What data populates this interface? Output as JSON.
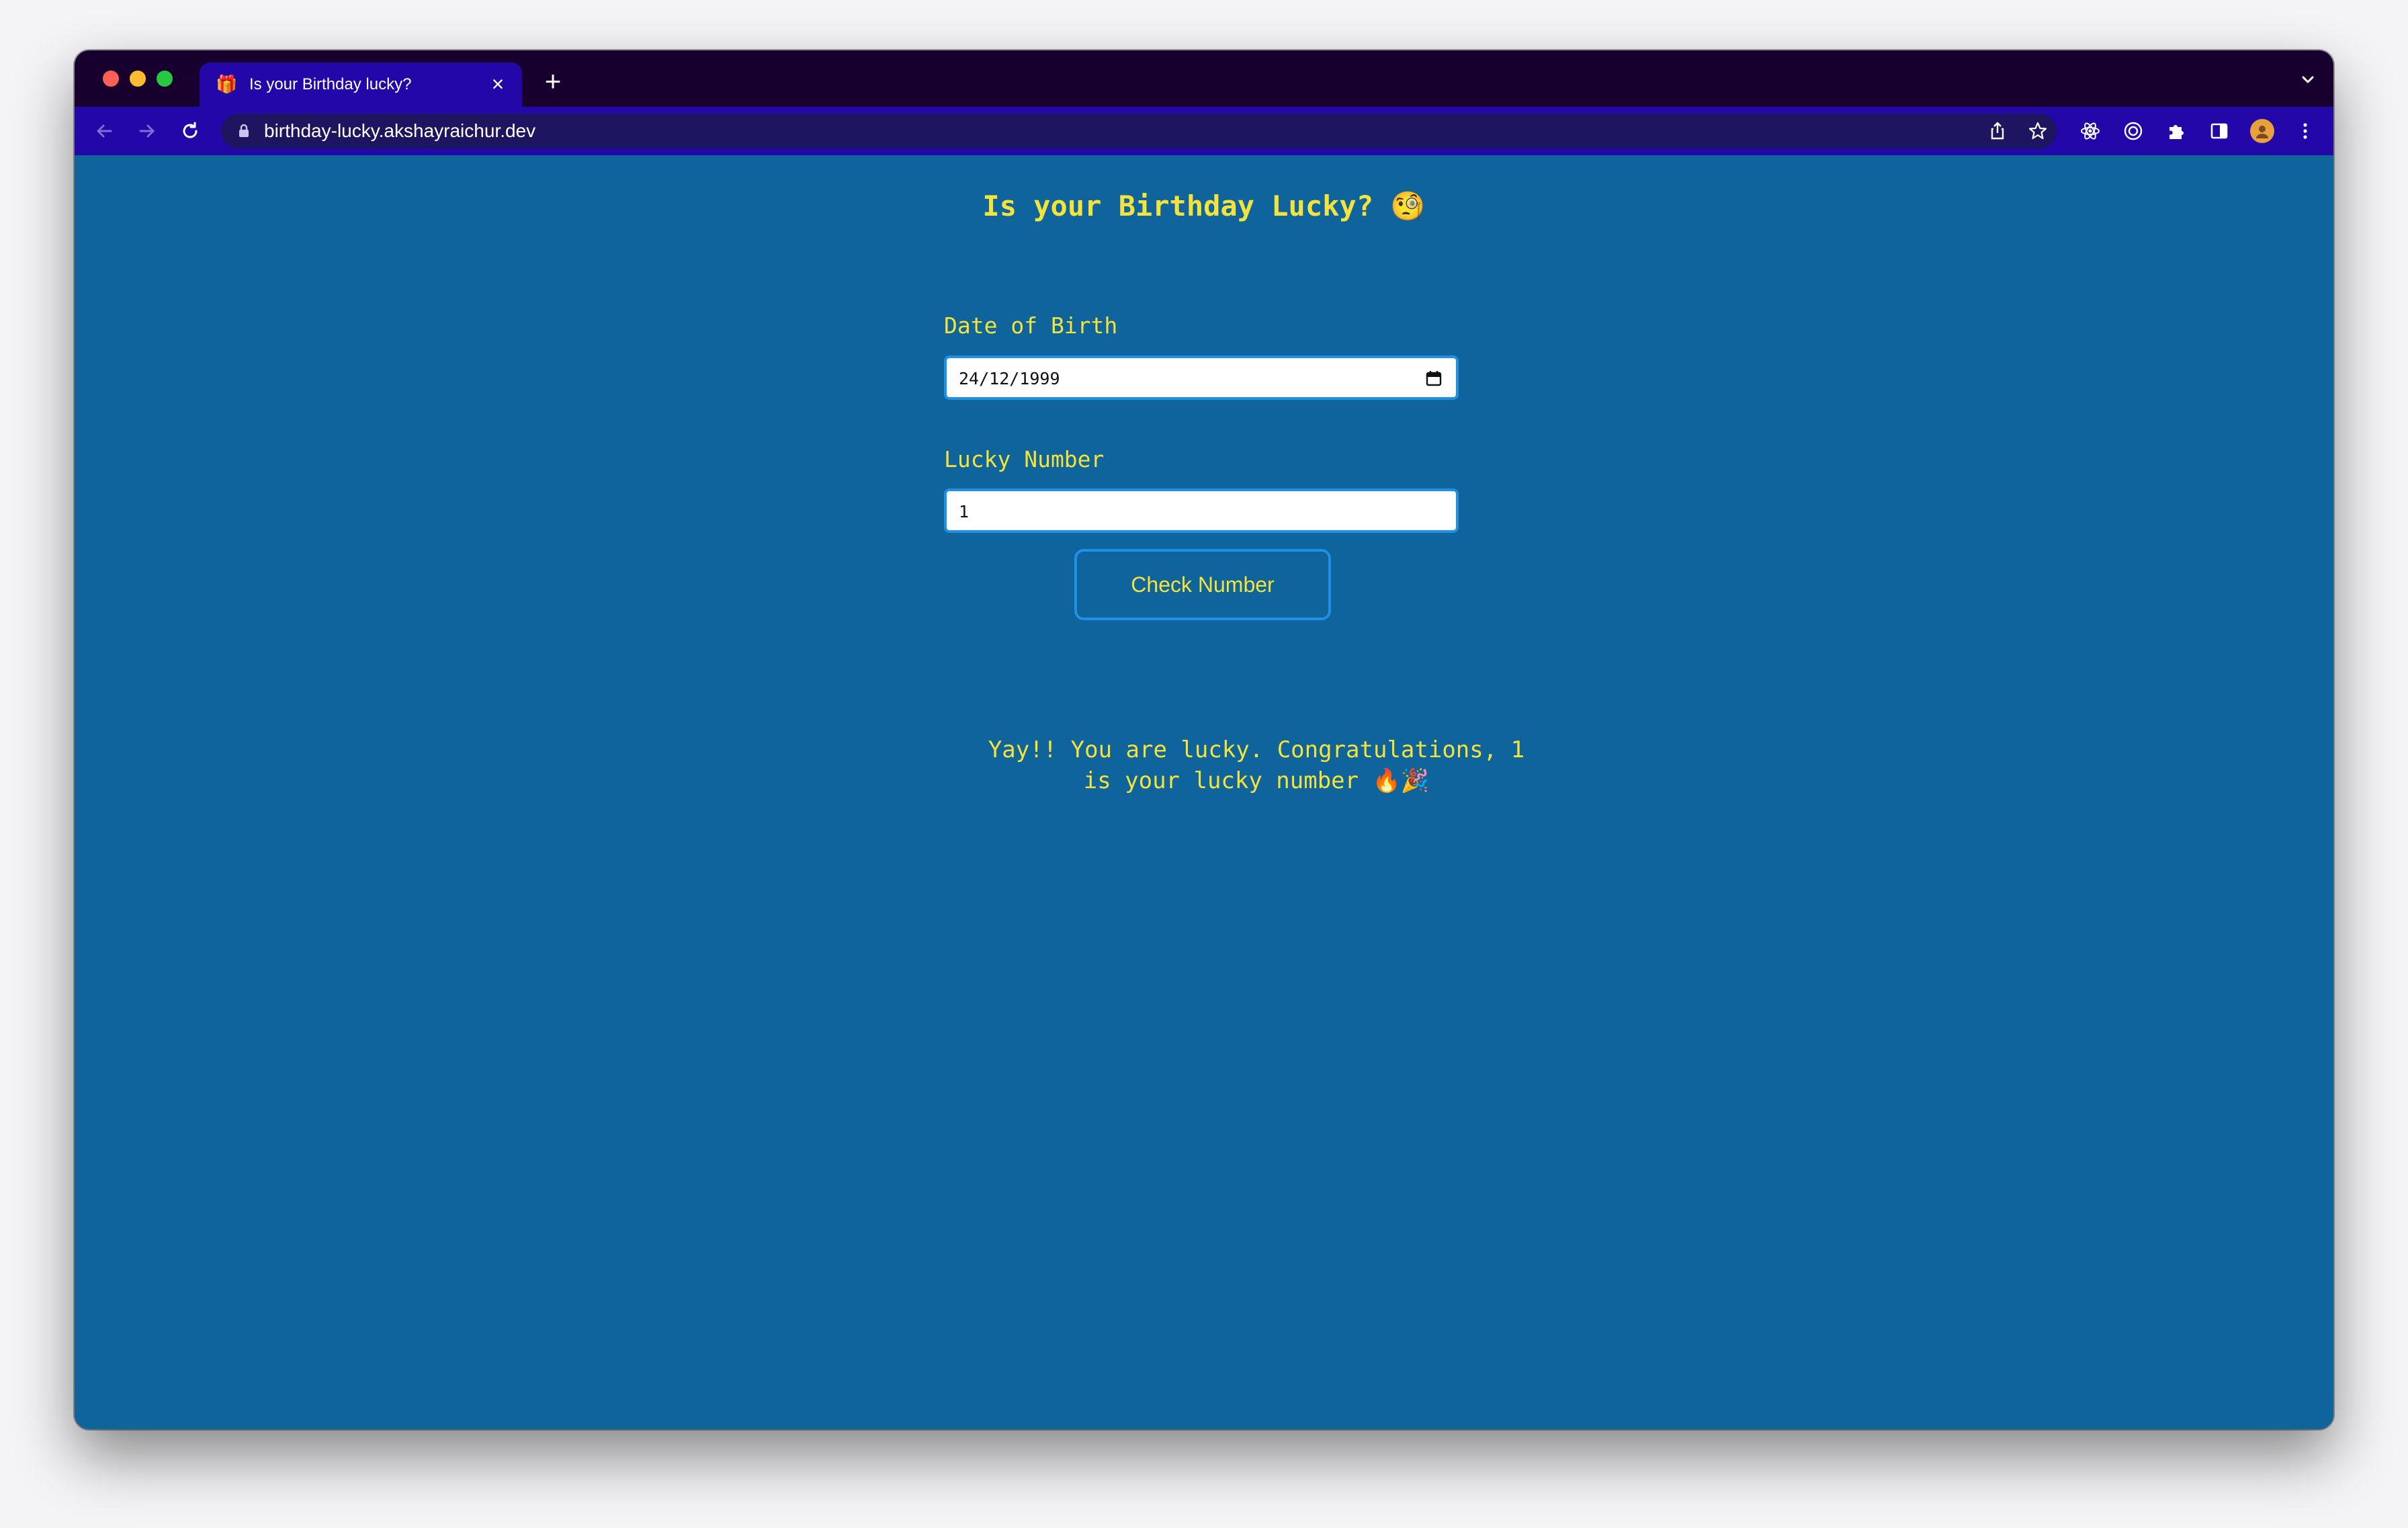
{
  "browser": {
    "tab": {
      "title": "Is your Birthday lucky?",
      "favicon": "gift-icon"
    },
    "url": "birthday-lucky.akshayraichur.dev"
  },
  "page": {
    "heading": "Is your Birthday Lucky? 🧐",
    "dob": {
      "label": "Date of Birth",
      "value": "24/12/1999"
    },
    "lucky": {
      "label": "Lucky Number",
      "value": "1"
    },
    "button_label": "Check Number",
    "result_line1": "Yay!! You are lucky. Congratulations, 1",
    "result_line2": "is your lucky number 🔥🎉"
  },
  "colors": {
    "page_background": "#0e649b",
    "text_accent": "#f4e33c",
    "input_border": "#1e90e8",
    "toolbar": "#2407a8",
    "titlebar": "#17002d"
  }
}
